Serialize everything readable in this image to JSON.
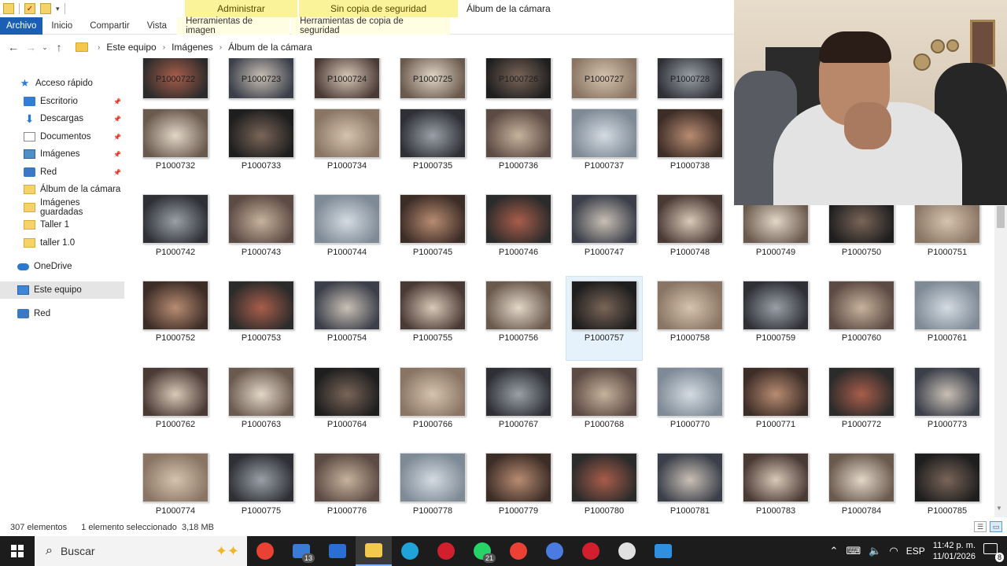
{
  "window": {
    "title": "Álbum de la cámara",
    "context_headers": [
      "Administrar",
      "Sin copia de seguridad"
    ],
    "ribbon_tabs": [
      "Archivo",
      "Inicio",
      "Compartir",
      "Vista"
    ],
    "context_tabs": [
      "Herramientas de imagen",
      "Herramientas de copia de seguridad"
    ]
  },
  "address": {
    "crumbs": [
      "Este equipo",
      "Imágenes",
      "Álbum de la cámara"
    ]
  },
  "nav": {
    "items": [
      {
        "label": "Acceso rápido",
        "icon": "star-icon",
        "pinned": false
      },
      {
        "label": "Escritorio",
        "icon": "desktop-icon",
        "pinned": true
      },
      {
        "label": "Descargas",
        "icon": "download-icon",
        "pinned": true
      },
      {
        "label": "Documentos",
        "icon": "documents-icon",
        "pinned": true
      },
      {
        "label": "Imágenes",
        "icon": "pictures-icon",
        "pinned": true
      },
      {
        "label": "Red",
        "icon": "network-icon",
        "pinned": true
      },
      {
        "label": "Álbum de la cámara",
        "icon": "folder-icon",
        "pinned": false
      },
      {
        "label": "Imágenes guardadas",
        "icon": "folder-icon",
        "pinned": false
      },
      {
        "label": "Taller 1",
        "icon": "folder-icon",
        "pinned": false
      },
      {
        "label": "taller 1.0",
        "icon": "folder-icon",
        "pinned": false
      },
      {
        "label": "OneDrive",
        "icon": "cloud-icon",
        "pinned": false
      },
      {
        "label": "Este equipo",
        "icon": "computer-icon",
        "pinned": false,
        "selected": true
      },
      {
        "label": "Red",
        "icon": "network-icon",
        "pinned": false
      }
    ]
  },
  "files": {
    "rows": [
      [
        "P1000722",
        "P1000723",
        "P1000724",
        "P1000725",
        "P1000726",
        "P1000727",
        "P1000728"
      ],
      [
        "P1000732",
        "P1000733",
        "P1000734",
        "P1000735",
        "P1000736",
        "P1000737",
        "P1000738"
      ],
      [
        "P1000742",
        "P1000743",
        "P1000744",
        "P1000745",
        "P1000746",
        "P1000747",
        "P1000748",
        "P1000749",
        "P1000750",
        "P1000751"
      ],
      [
        "P1000752",
        "P1000753",
        "P1000754",
        "P1000755",
        "P1000756",
        "P1000757",
        "P1000758",
        "P1000759",
        "P1000760",
        "P1000761"
      ],
      [
        "P1000762",
        "P1000763",
        "P1000764",
        "P1000766",
        "P1000767",
        "P1000768",
        "P1000770",
        "P1000771",
        "P1000772",
        "P1000773"
      ],
      [
        "P1000774",
        "P1000775",
        "P1000776",
        "P1000778",
        "P1000779",
        "P1000780",
        "P1000781",
        "P1000783",
        "P1000784",
        "P1000785"
      ]
    ],
    "selected": "P1000757"
  },
  "status": {
    "count": "307 elementos",
    "selection": "1 elemento seleccionado  3,18 MB"
  },
  "taskbar": {
    "search_placeholder": "Buscar",
    "apps": [
      {
        "name": "chrome-icon",
        "color": "#e94235"
      },
      {
        "name": "mail-icon",
        "color": "#3a7bd5",
        "badge": "13"
      },
      {
        "name": "store-icon",
        "color": "#2b6fd6"
      },
      {
        "name": "file-explorer-icon",
        "color": "#f2c94c",
        "active": true
      },
      {
        "name": "edge-icon",
        "color": "#1fa3d8"
      },
      {
        "name": "opera-icon",
        "color": "#d21f2d"
      },
      {
        "name": "whatsapp-icon",
        "color": "#25d366",
        "badge": "21"
      },
      {
        "name": "chrome-alt-icon",
        "color": "#e94235"
      },
      {
        "name": "globe-icon",
        "color": "#4a7be0"
      },
      {
        "name": "opera-gx-icon",
        "color": "#d21f2d"
      },
      {
        "name": "recorder-icon",
        "color": "#e0e0e0"
      },
      {
        "name": "photos-icon",
        "color": "#2f8fe0"
      }
    ],
    "language": "ESP",
    "time": "11:42 p. m.",
    "date": "11/01/2026",
    "notifications": "8"
  }
}
